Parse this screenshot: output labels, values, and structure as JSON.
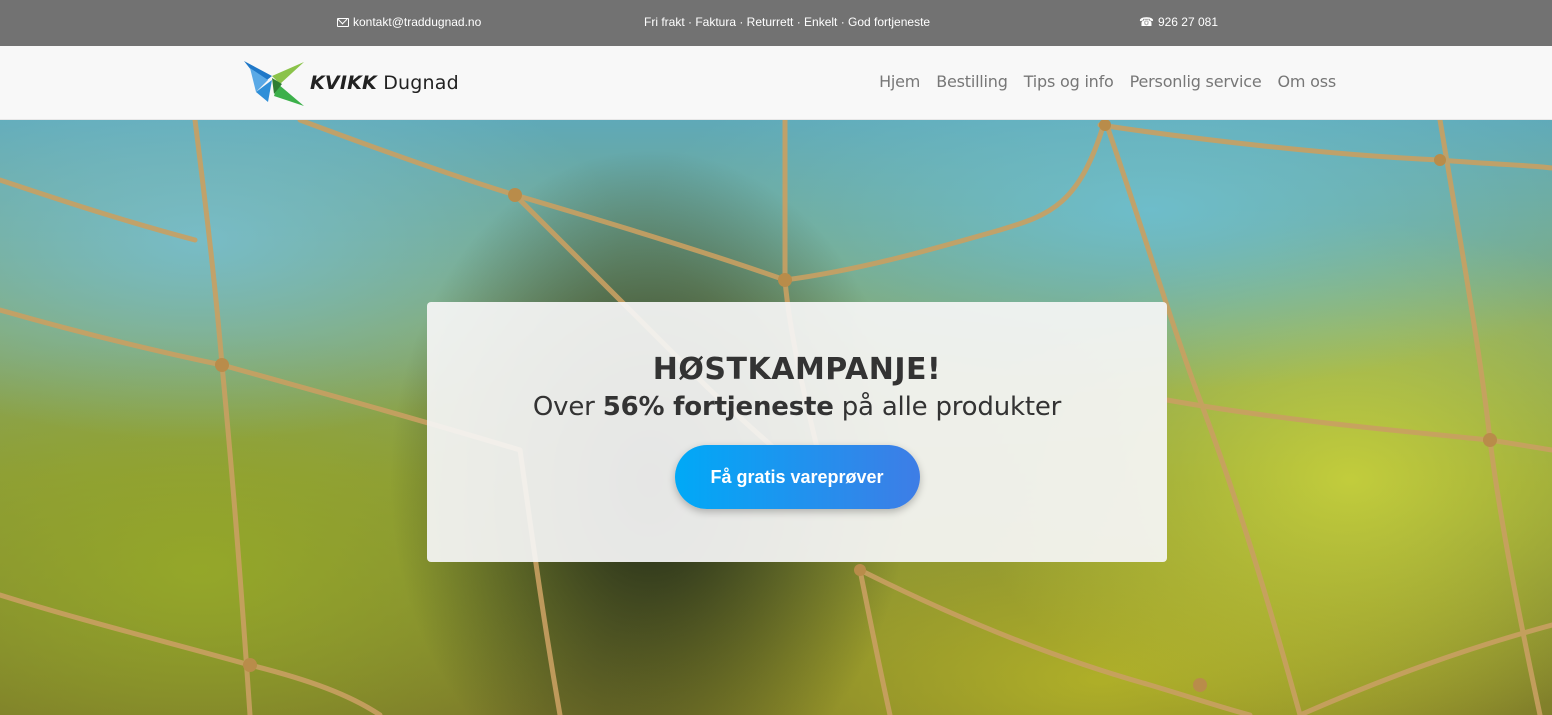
{
  "topbar": {
    "email": "kontakt@traddugnad.no",
    "usp": "Fri frakt · Faktura · Returrett · Enkelt · God fortjeneste",
    "phone": "926 27 081",
    "phone_icon": "☎"
  },
  "brand": {
    "name_bold": "KVIKK",
    "name_light": "Dugnad",
    "logo_icon": "butterfly-logo-icon"
  },
  "nav": {
    "items": [
      "Hjem",
      "Bestilling",
      "Tips og info",
      "Personlig service",
      "Om oss"
    ]
  },
  "hero": {
    "title": "HØSTKAMPANJE!",
    "subtitle_pre": "Over",
    "subtitle_bold": "56% fortjeneste",
    "subtitle_post": "på alle produkter",
    "cta_label": "Få gratis vareprøver"
  },
  "colors": {
    "topbar_bg": "#727272",
    "navbar_bg": "#f8f8f8",
    "cta_start": "#00a9f7",
    "cta_end": "#3e7de6",
    "logo_blue": "#2f8fd8",
    "logo_green": "#3cb04a"
  }
}
